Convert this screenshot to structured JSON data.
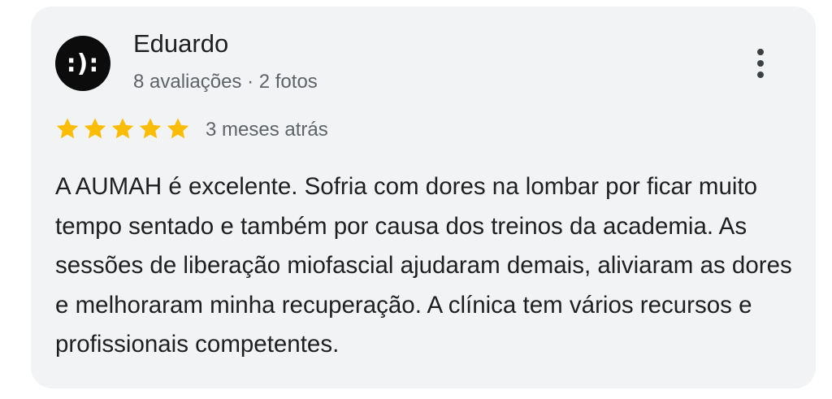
{
  "review": {
    "avatar_text": ":):",
    "reviewer_name": "Eduardo",
    "reviewer_meta": "8 avaliações · 2 fotos",
    "rating": 5,
    "rating_max": 5,
    "star_color": "#fbbc04",
    "time_ago": "3 meses atrás",
    "text": "A AUMAH é excelente. Sofria com dores na lombar por ficar muito tempo sentado e também por causa dos treinos da academia. As sessões de liberação miofascial ajudaram demais, aliviaram as dores e melhoraram minha recuperação. A clínica tem vários recursos e profissionais competentes.",
    "menu_icon": "more-vertical-icon"
  }
}
